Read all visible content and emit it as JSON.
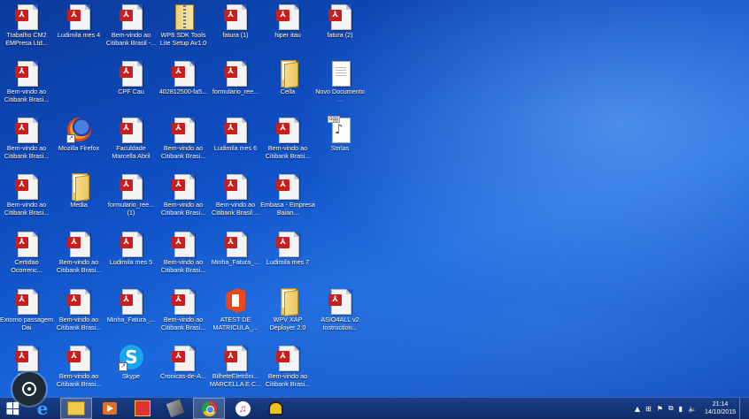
{
  "desktop": {
    "icons": [
      {
        "label": "Trabalho CM2 EMPresa Ltd...",
        "type": "pdf"
      },
      {
        "label": "Ludimila mes 4",
        "type": "pdf"
      },
      {
        "label": "Bem-vindo ao Citibank Brasil -...",
        "type": "pdf"
      },
      {
        "label": "WP8 SDK Tools Lite Setup Av1.0",
        "type": "zip"
      },
      {
        "label": "fatura (1)",
        "type": "pdf"
      },
      {
        "label": "hiper itau",
        "type": "pdf"
      },
      {
        "label": "fatura (2)",
        "type": "pdf"
      },
      {
        "label": "Bem-vindo ao Citibank Brasi...",
        "type": "pdf"
      },
      {
        "label": "CPF Cau",
        "type": "pdf"
      },
      {
        "label": "402812500-fa5...",
        "type": "pdf"
      },
      {
        "label": "formulario_ree...",
        "type": "pdf"
      },
      {
        "label": "Cella",
        "type": "folder"
      },
      {
        "label": "Novo Documento ...",
        "type": "doc"
      },
      {
        "label": "Bem-vindo ao Citibank Brasi...",
        "type": "pdf"
      },
      {
        "label": "Mozilla Firefox",
        "type": "firefox"
      },
      {
        "label": "Faculdade Marcella Abril",
        "type": "pdf"
      },
      {
        "label": "Bem-vindo ao Citibank Brasi...",
        "type": "pdf"
      },
      {
        "label": "Ludimila mes 6",
        "type": "pdf"
      },
      {
        "label": "Bem-vindo ao Citibank Brasi...",
        "type": "pdf"
      },
      {
        "label": "Strrlas",
        "type": "audio"
      },
      {
        "label": "Bem-vindo ao Citibank Brasi...",
        "type": "pdf"
      },
      {
        "label": "Media",
        "type": "folder"
      },
      {
        "label": "formulario_ree... (1)",
        "type": "pdf"
      },
      {
        "label": "Bem-vindo ao Citibank Brasi...",
        "type": "pdf"
      },
      {
        "label": "Bem-vindo ao Citibank Brasil ...",
        "type": "pdf"
      },
      {
        "label": "Embasa - Empresa Baian...",
        "type": "pdf"
      },
      {
        "label": "Certidao Ocorrenc...",
        "type": "pdf"
      },
      {
        "label": "Bem-vindo ao Citibank Brasi...",
        "type": "pdf"
      },
      {
        "label": "Ludimila mes 5",
        "type": "pdf"
      },
      {
        "label": "Bem-vindo ao Citibank Brasi...",
        "type": "pdf"
      },
      {
        "label": "Minha_Fatura_...",
        "type": "pdf"
      },
      {
        "label": "Ludimila mes 7",
        "type": "pdf"
      },
      {
        "label": "Extorno passagem Dai",
        "type": "pdf"
      },
      {
        "label": "Bem-vindo ao Citibank Brasi...",
        "type": "pdf"
      },
      {
        "label": "Minha_Fatura_...",
        "type": "pdf"
      },
      {
        "label": "Bem-vindo ao Citibank Brasi...",
        "type": "pdf"
      },
      {
        "label": "ATEST DE MATRICULA_...",
        "type": "office"
      },
      {
        "label": "WPV XAP Deployer 2.0",
        "type": "folder"
      },
      {
        "label": "ASIO4ALL v2 Instruction...",
        "type": "pdf"
      },
      {
        "label": "fatura",
        "type": "pdf"
      },
      {
        "label": "Bem-vindo ao Citibank Brasi...",
        "type": "pdf"
      },
      {
        "label": "Skype",
        "type": "skype"
      },
      {
        "label": "Cronicas-de-A...",
        "type": "pdf"
      },
      {
        "label": "BilheteEletrôni... MARCELLA E C...",
        "type": "pdf"
      },
      {
        "label": "Bem-vindo ao Citibank Brasi...",
        "type": "pdf"
      }
    ]
  },
  "taskbar": {
    "apps": [
      "start-icon",
      "ie-icon",
      "file-explorer-icon",
      "media-player-icon",
      "gift-icon",
      "phone-icon",
      "chrome-icon",
      "itunes-icon",
      "headset-icon"
    ],
    "active_app": "file-explorer-icon",
    "clock_time": "21:14",
    "clock_date": "14/10/2015"
  },
  "colors": {
    "desktop_blue": "#0f4fc4",
    "taskbar": "#193f8a",
    "pdf_red": "#c81e1e"
  }
}
